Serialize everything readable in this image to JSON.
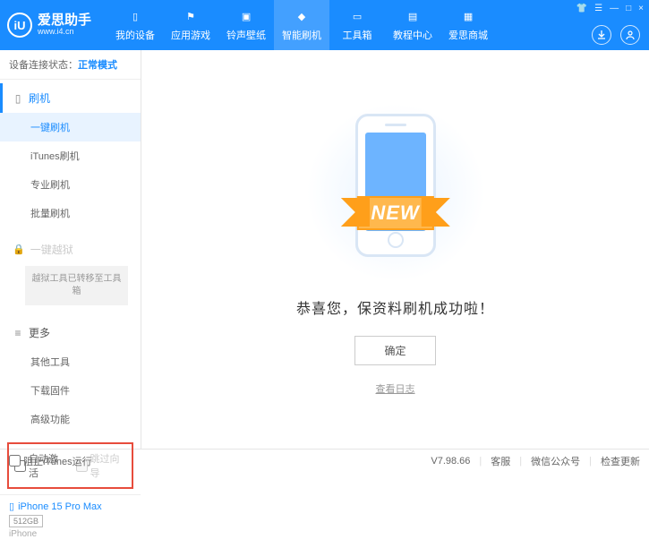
{
  "app": {
    "name": "爱思助手",
    "url": "www.i4.cn",
    "logo_letter": "iU"
  },
  "win_controls": {
    "menu": "▾",
    "settings": "☰",
    "min": "—",
    "max": "□",
    "close": "×"
  },
  "nav": [
    {
      "label": "我的设备"
    },
    {
      "label": "应用游戏"
    },
    {
      "label": "铃声壁纸"
    },
    {
      "label": "智能刷机"
    },
    {
      "label": "工具箱"
    },
    {
      "label": "教程中心"
    },
    {
      "label": "爱思商城"
    }
  ],
  "status": {
    "label": "设备连接状态：",
    "value": "正常模式"
  },
  "sidebar": {
    "flash_head": "刷机",
    "flash_items": [
      "一键刷机",
      "iTunes刷机",
      "专业刷机",
      "批量刷机"
    ],
    "jailbreak_head": "一键越狱",
    "jailbreak_note": "越狱工具已转移至工具箱",
    "more_head": "更多",
    "more_items": [
      "其他工具",
      "下载固件",
      "高级功能"
    ]
  },
  "checks": {
    "auto_activate": "自动激活",
    "skip_wizard": "跳过向导"
  },
  "device": {
    "name": "iPhone 15 Pro Max",
    "storage": "512GB",
    "type": "iPhone"
  },
  "main": {
    "ribbon": "NEW",
    "message": "恭喜您，保资料刷机成功啦！",
    "ok": "确定",
    "log": "查看日志"
  },
  "footer": {
    "block_itunes": "阻止iTunes运行",
    "version": "V7.98.66",
    "links": [
      "客服",
      "微信公众号",
      "检查更新"
    ]
  }
}
